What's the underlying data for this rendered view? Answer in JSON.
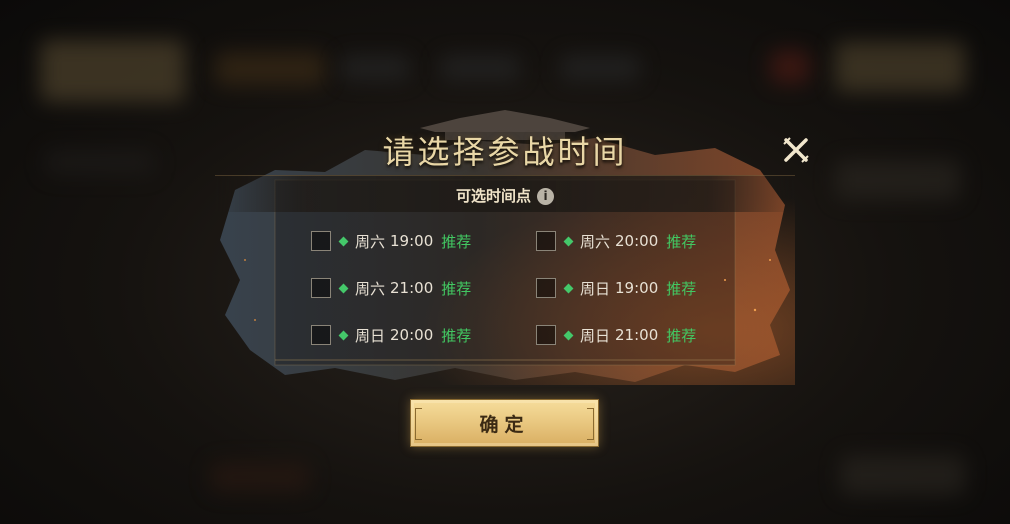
{
  "dialog": {
    "title": "请选择参战时间",
    "subtitle": "可选时间点",
    "info_icon": "info-icon",
    "close_icon": "close-x-icon"
  },
  "time_slots": [
    {
      "day": "周六",
      "time": "19:00",
      "tag": "推荐",
      "checked": false
    },
    {
      "day": "周六",
      "time": "20:00",
      "tag": "推荐",
      "checked": false
    },
    {
      "day": "周六",
      "time": "21:00",
      "tag": "推荐",
      "checked": false
    },
    {
      "day": "周日",
      "time": "19:00",
      "tag": "推荐",
      "checked": false
    },
    {
      "day": "周日",
      "time": "20:00",
      "tag": "推荐",
      "checked": false
    },
    {
      "day": "周日",
      "time": "21:00",
      "tag": "推荐",
      "checked": false
    }
  ],
  "confirm_button": {
    "label": "确定"
  },
  "colors": {
    "title_gold": "#e9d7a6",
    "recommend_green": "#42c862",
    "button_gold": "#eac982"
  }
}
